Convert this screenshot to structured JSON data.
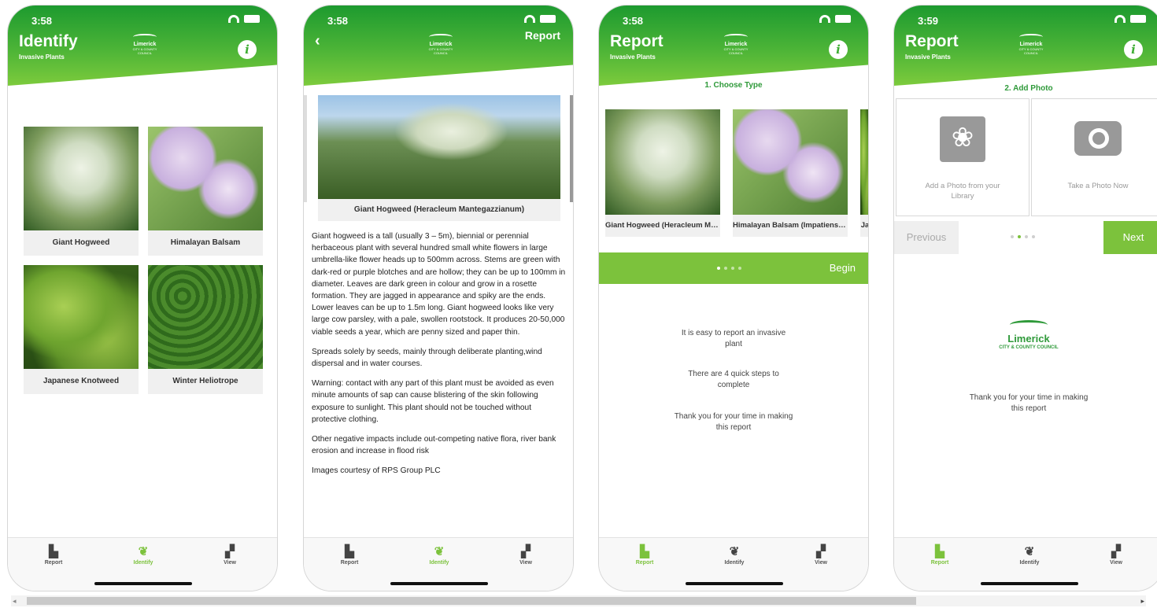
{
  "colors": {
    "brand_green": "#3fae34",
    "accent_green": "#7cc23c",
    "title_green": "#2f9a3a"
  },
  "logo": {
    "name": "Limerick",
    "sub": "CITY & COUNTY COUNCIL"
  },
  "tabs": [
    {
      "label": "Report",
      "icon": "report-icon"
    },
    {
      "label": "Identify",
      "icon": "leaf-icon"
    },
    {
      "label": "View",
      "icon": "map-icon"
    }
  ],
  "screens": {
    "identify": {
      "time": "3:58",
      "title": "Identify",
      "subtitle": "Invasive Plants",
      "plants": [
        {
          "name": "Giant Hogweed"
        },
        {
          "name": "Himalayan Balsam"
        },
        {
          "name": "Japanese Knotweed"
        },
        {
          "name": "Winter Heliotrope"
        }
      ]
    },
    "detail": {
      "time": "3:58",
      "report_link": "Report",
      "caption": "Giant Hogweed (Heracleum Mantegazzianum)",
      "paragraphs": [
        "Giant hogweed is a tall (usually 3 – 5m), biennial or perennial herbaceous plant with several hundred small white flowers in large umbrella-like flower heads up to 500mm across. Stems are green with dark-red or purple blotches and are hollow; they can be up to 100mm in diameter. Leaves are dark green in colour and grow in a rosette formation. They are jagged in appearance and spiky are the ends. Lower leaves can be up to 1.5m long. Giant hogweed looks like very large cow parsley, with a pale, swollen rootstock. It produces 20-50,000 viable seeds a year, which are penny sized and paper thin.",
        "Spreads solely by seeds, mainly through deliberate planting,wind dispersal and in water courses.",
        "Warning: contact with any part of this plant must be avoided as even minute amounts of sap can cause blistering of the skin following exposure to sunlight. This plant should not be touched without protective clothing.",
        "Other negative impacts include out-competing native flora, river bank erosion and increase in flood risk",
        "Images courtesy of RPS Group PLC"
      ]
    },
    "choose_type": {
      "time": "3:58",
      "title": "Report",
      "subtitle": "Invasive Plants",
      "step": "1. Choose Type",
      "types": [
        {
          "name": "Giant Hogweed (Heracleum Mantegazzianum)"
        },
        {
          "name": "Himalayan Balsam (Impatiens glandulifera)"
        },
        {
          "name": "Ja"
        }
      ],
      "begin": "Begin",
      "messages": [
        "It is easy to report an invasive plant",
        "There are 4 quick steps to complete",
        "Thank you for your time in making this report"
      ]
    },
    "add_photo": {
      "time": "3:59",
      "title": "Report",
      "subtitle": "Invasive Plants",
      "step": "2. Add Photo",
      "library_label": "Add a Photo from your Library",
      "camera_label": "Take a Photo Now",
      "previous": "Previous",
      "next": "Next",
      "thanks": "Thank you for your time in making this report"
    }
  },
  "scrollbar": {
    "left_arrow": "◂",
    "right_arrow": "▸"
  }
}
